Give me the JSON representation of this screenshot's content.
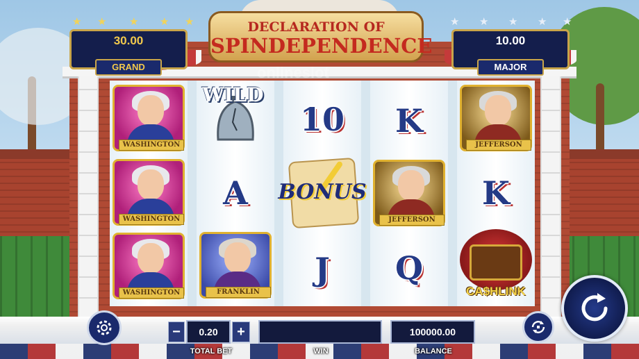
{
  "game": {
    "title_line1": "DECLARATION OF",
    "title_line2": "SPINDEPENDENCE",
    "watermark": "onlineslot"
  },
  "jackpots": {
    "grand": {
      "label": "GRAND",
      "value": "30.00",
      "color": "#f2c94c"
    },
    "major": {
      "label": "MAJOR",
      "value": "10.00",
      "color": "#ffffff"
    }
  },
  "reels": [
    {
      "symbols": [
        {
          "type": "portrait",
          "name": "WASHINGTON"
        },
        {
          "type": "portrait",
          "name": "WASHINGTON"
        },
        {
          "type": "portrait",
          "name": "WASHINGTON"
        }
      ]
    },
    {
      "symbols": [
        {
          "type": "wild",
          "label": "WILD"
        },
        {
          "type": "card",
          "label": "A"
        },
        {
          "type": "portrait",
          "name": "FRANKLIN"
        }
      ]
    },
    {
      "symbols": [
        {
          "type": "card",
          "label": "10"
        },
        {
          "type": "bonus",
          "label": "BONUS"
        },
        {
          "type": "card",
          "label": "J"
        }
      ]
    },
    {
      "symbols": [
        {
          "type": "card",
          "label": "K"
        },
        {
          "type": "portrait",
          "name": "JEFFERSON"
        },
        {
          "type": "card",
          "label": "Q"
        }
      ]
    },
    {
      "symbols": [
        {
          "type": "portrait",
          "name": "JEFFERSON"
        },
        {
          "type": "card",
          "label": "K"
        },
        {
          "type": "cashlink",
          "label": "CA$HLINK"
        }
      ]
    }
  ],
  "controls": {
    "minus": "−",
    "plus": "+",
    "total_bet_value": "0.20",
    "total_bet_label": "TOTAL BET",
    "win_value": "",
    "win_label": "WIN",
    "balance_value": "100000.00",
    "balance_label": "BALANCE",
    "settings_icon": "gear-icon",
    "autoplay_icon": "autoplay-icon",
    "spin_icon": "spin-icon"
  }
}
